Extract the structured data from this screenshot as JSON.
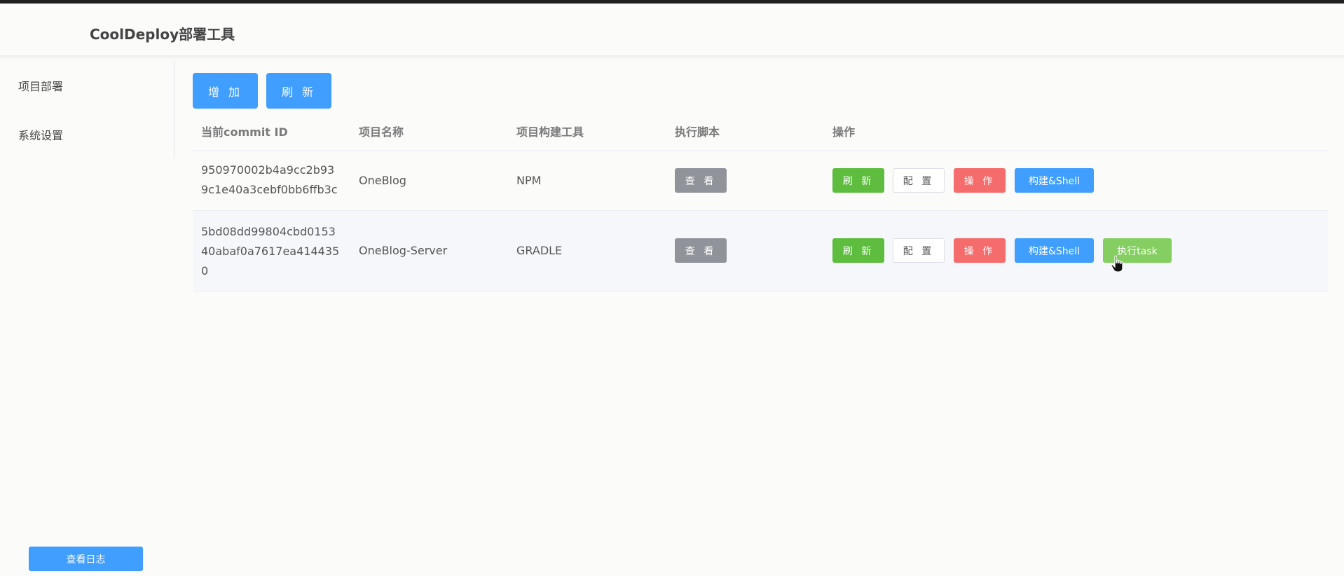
{
  "app": {
    "title": "CoolDeploy部署工具"
  },
  "sidebar": {
    "items": [
      {
        "label": "项目部署"
      },
      {
        "label": "系统设置"
      }
    ],
    "log_button": "查看日志"
  },
  "toolbar": {
    "add_label": "增 加",
    "refresh_label": "刷 新"
  },
  "table": {
    "headers": [
      "当前commit ID",
      "项目名称",
      "项目构建工具",
      "执行脚本",
      "操作"
    ],
    "rows": [
      {
        "commit_id": "950970002b4a9cc2b939c1e40a3cebf0bb6ffb3c",
        "name": "OneBlog",
        "build_tool": "NPM",
        "script_button": "查 看",
        "actions": {
          "refresh": "刷 新",
          "config": "配 置",
          "operate": "操 作",
          "build": "构建&Shell"
        }
      },
      {
        "commit_id": "5bd08dd99804cbd015340abaf0a7617ea4144350",
        "name": "OneBlog-Server",
        "build_tool": "GRADLE",
        "script_button": "查 看",
        "actions": {
          "refresh": "刷 新",
          "config": "配 置",
          "operate": "操 作",
          "build": "构建&Shell",
          "task": "执行task"
        }
      }
    ]
  },
  "colors": {
    "primary": "#409eff",
    "success": "#67c23a",
    "danger": "#f56c6c",
    "info": "#909399",
    "task": "#85ce61"
  }
}
